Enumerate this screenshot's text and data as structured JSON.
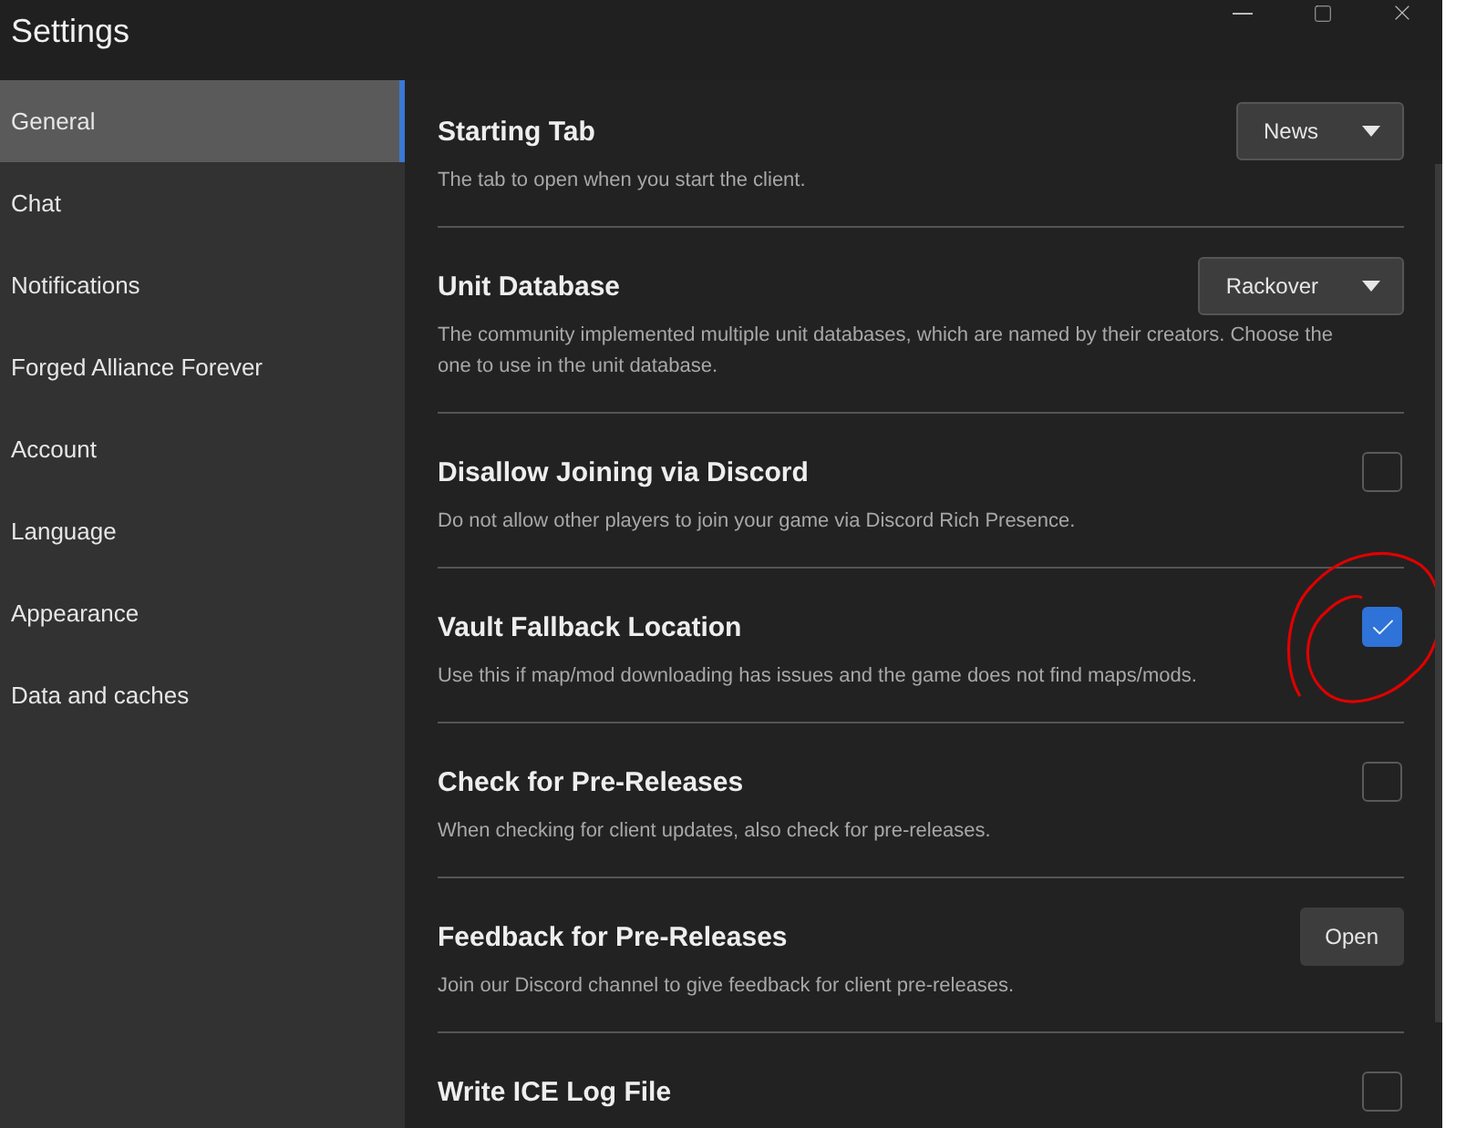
{
  "window": {
    "title": "Settings"
  },
  "sidebar": {
    "items": [
      {
        "label": "General",
        "selected": true
      },
      {
        "label": "Chat",
        "selected": false
      },
      {
        "label": "Notifications",
        "selected": false
      },
      {
        "label": "Forged Alliance Forever",
        "selected": false
      },
      {
        "label": "Account",
        "selected": false
      },
      {
        "label": "Language",
        "selected": false
      },
      {
        "label": "Appearance",
        "selected": false
      },
      {
        "label": "Data and caches",
        "selected": false
      }
    ]
  },
  "settings": [
    {
      "kind": "dropdown",
      "title": "Starting Tab",
      "description": "The tab to open when you start the client.",
      "value": "News"
    },
    {
      "kind": "dropdown",
      "title": "Unit Database",
      "description": "The community implemented multiple unit databases, which are named by their creators. Choose the one to use in the unit database.",
      "value": "Rackover"
    },
    {
      "kind": "checkbox",
      "title": "Disallow Joining via Discord",
      "description": "Do not allow other players to join your game via Discord Rich Presence.",
      "checked": false
    },
    {
      "kind": "checkbox",
      "title": "Vault Fallback Location",
      "description": "Use this if map/mod downloading has issues and the game does not find maps/mods.",
      "checked": true,
      "annotated": true
    },
    {
      "kind": "checkbox",
      "title": "Check for Pre-Releases",
      "description": "When checking for client updates, also check for pre-releases.",
      "checked": false
    },
    {
      "kind": "button",
      "title": "Feedback for Pre-Releases",
      "description": "Join our Discord channel to give feedback for client pre-releases.",
      "button": "Open"
    },
    {
      "kind": "checkbox",
      "title": "Write ICE Log File",
      "checked": false
    }
  ]
}
